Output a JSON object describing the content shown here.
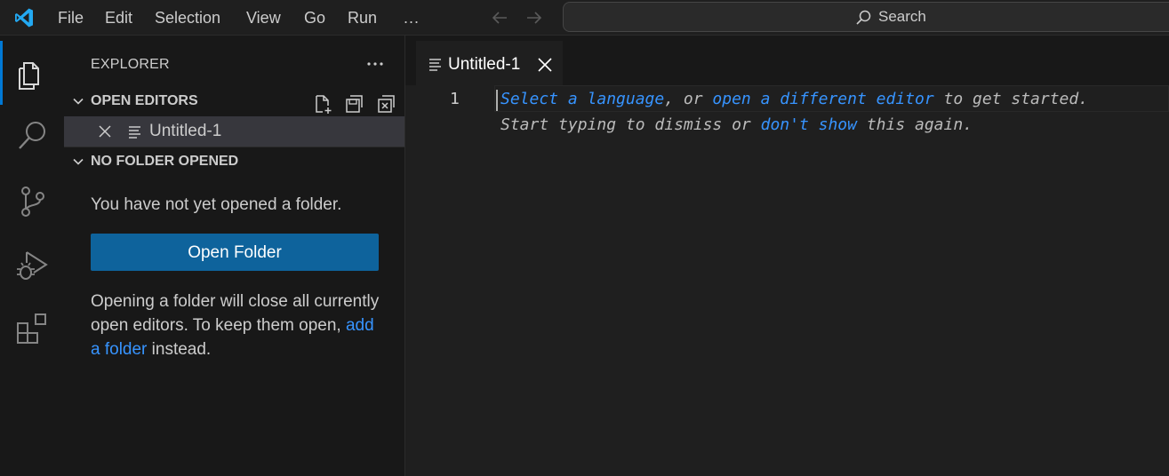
{
  "menu": [
    "File",
    "Edit",
    "Selection",
    "View",
    "Go",
    "Run",
    "..."
  ],
  "search": {
    "label": "Search"
  },
  "sidebar": {
    "title": "EXPLORER",
    "open_editors": {
      "title": "OPEN EDITORS",
      "items": [
        {
          "name": "Untitled-1"
        }
      ]
    },
    "no_folder": {
      "title": "NO FOLDER OPENED",
      "message": "You have not yet opened a folder.",
      "button": "Open Folder",
      "hint_prefix": "Opening a folder will close all currently open editors. To keep them open, ",
      "hint_link": "add a folder",
      "hint_suffix": " instead."
    }
  },
  "editor": {
    "tab": {
      "name": "Untitled-1"
    },
    "line_number": "1",
    "hint_line1": {
      "link1": "Select a language",
      "text1": ", or ",
      "link2": "open a different editor",
      "text2": " to get started."
    },
    "hint_line2": {
      "text1": "Start typing to dismiss or ",
      "link": "don't show",
      "text2": " this again."
    }
  },
  "colors": {
    "accent": "#0078d4",
    "button": "#0e639c",
    "link": "#3794ff",
    "background": "#1f1f1f",
    "sidebar": "#181818"
  },
  "icons": [
    "vscode-logo",
    "back-arrow-icon",
    "forward-arrow-icon",
    "search-icon",
    "explorer-icon",
    "search-view-icon",
    "source-control-icon",
    "run-debug-icon",
    "extensions-icon",
    "more-icon",
    "chevron-down-icon",
    "new-file-icon",
    "save-all-icon",
    "close-all-icon",
    "close-icon",
    "file-icon"
  ]
}
